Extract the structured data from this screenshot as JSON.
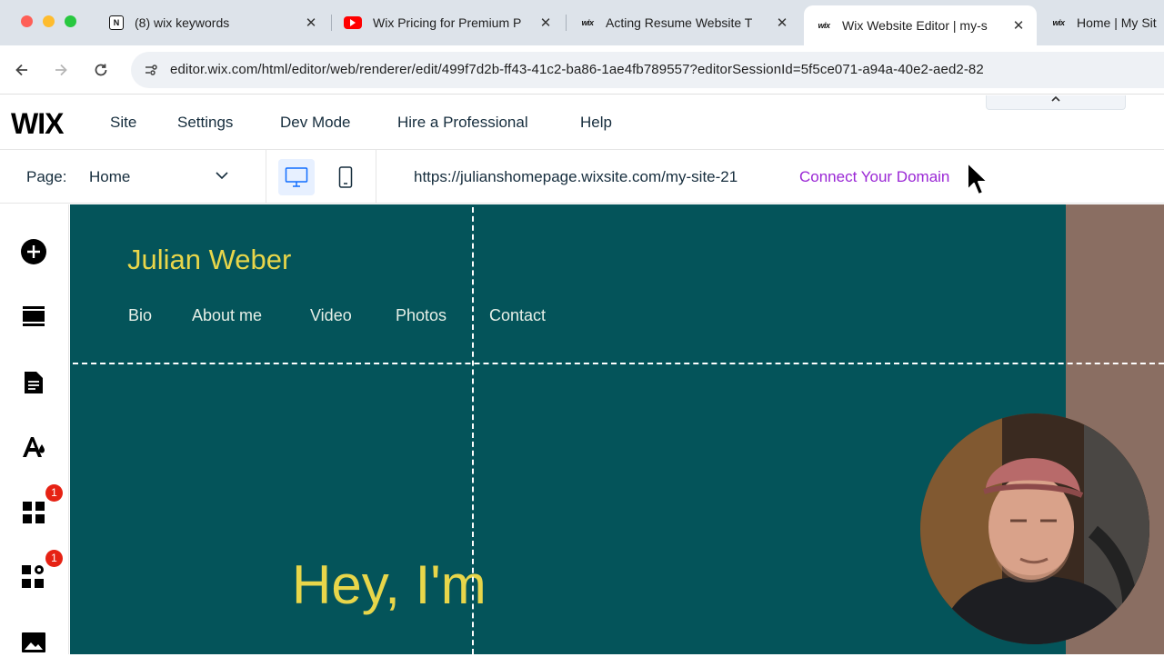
{
  "browser": {
    "tabs": [
      {
        "title": "(8) wix keywords",
        "favicon": "notion-icon"
      },
      {
        "title": "Wix Pricing for Premium P",
        "favicon": "youtube-icon"
      },
      {
        "title": "Acting Resume Website T",
        "favicon": "wix-icon"
      },
      {
        "title": "Wix Website Editor | my-s",
        "favicon": "wix-icon",
        "active": true
      },
      {
        "title": "Home | My Sit",
        "favicon": "wix-icon"
      }
    ],
    "favicon_text": {
      "notion": "N",
      "wix": "wix"
    },
    "url": "editor.wix.com/html/editor/web/renderer/edit/499f7d2b-ff43-41c2-ba86-1ae4fb789557?editorSessionId=5f5ce071-a94a-40e2-aed2-82"
  },
  "wix": {
    "logo": "WIX",
    "menu": [
      "Site",
      "Settings",
      "Dev Mode",
      "Hire a Professional",
      "Help"
    ],
    "page_label": "Page:",
    "page_value": "Home",
    "site_url": "https://julianshomepage.wixsite.com/my-site-21",
    "connect_domain": "Connect Your Domain",
    "left_tools": [
      {
        "icon": "add-icon"
      },
      {
        "icon": "sections-icon"
      },
      {
        "icon": "pages-icon"
      },
      {
        "icon": "design-icon"
      },
      {
        "icon": "apps-icon",
        "badge": "1"
      },
      {
        "icon": "business-tools-icon",
        "badge": "1"
      },
      {
        "icon": "media-icon"
      }
    ]
  },
  "site": {
    "name": "Julian Weber",
    "nav": [
      "Bio",
      "About me",
      "Video",
      "Photos",
      "Contact"
    ],
    "hero": "Hey, I'm"
  },
  "colors": {
    "canvas_bg": "#04545a",
    "accent_yellow": "#e8d64a",
    "connect_purple": "#9a27d5",
    "badge_red": "#e62214"
  }
}
